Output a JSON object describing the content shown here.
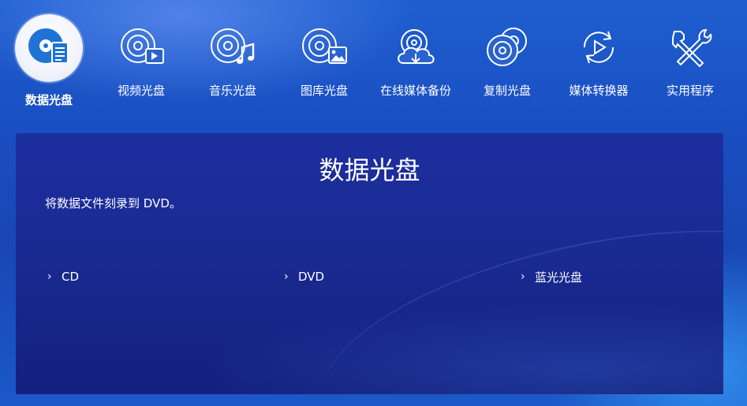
{
  "nav": {
    "items": [
      {
        "label": "数据光盘",
        "icon": "data-disc-icon",
        "active": true
      },
      {
        "label": "视频光盘",
        "icon": "video-disc-icon"
      },
      {
        "label": "音乐光盘",
        "icon": "music-disc-icon"
      },
      {
        "label": "图库光盘",
        "icon": "photo-disc-icon"
      },
      {
        "label": "在线媒体备份",
        "icon": "cloud-backup-icon"
      },
      {
        "label": "复制光盘",
        "icon": "copy-disc-icon"
      },
      {
        "label": "媒体转换器",
        "icon": "media-converter-icon"
      },
      {
        "label": "实用程序",
        "icon": "tools-icon"
      }
    ]
  },
  "panel": {
    "title": "数据光盘",
    "description": "将数据文件刻录到 DVD。",
    "options": [
      {
        "label": "CD"
      },
      {
        "label": "DVD"
      },
      {
        "label": "蓝光光盘"
      }
    ]
  },
  "colors": {
    "accent_blue": "#2a66d8",
    "panel_bg": "#1a2a93",
    "text": "#ffffff"
  }
}
